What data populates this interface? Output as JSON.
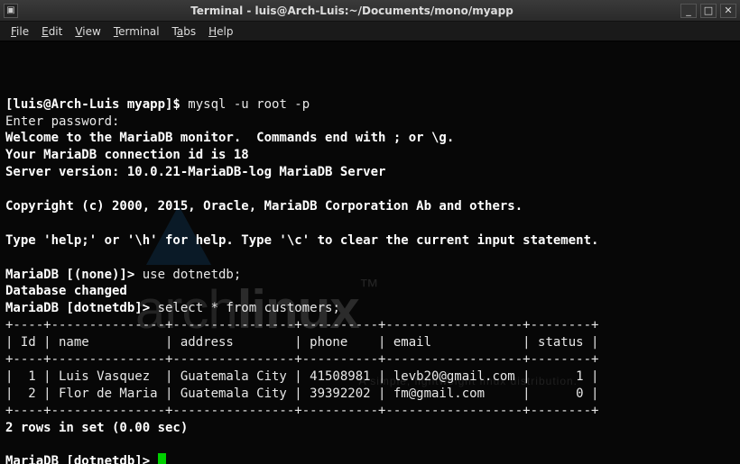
{
  "window": {
    "title": "Terminal - luis@Arch-Luis:~/Documents/mono/myapp"
  },
  "menu": {
    "file": "File",
    "edit": "Edit",
    "view": "View",
    "terminal": "Terminal",
    "tabs": "Tabs",
    "help": "Help"
  },
  "watermark": {
    "brand1": "arch",
    "brand2": "linux",
    "tagline": "A simple, lightweight linux distribution."
  },
  "session": {
    "shell_prompt": "[luis@Arch-Luis myapp]$ ",
    "cmd1": "mysql -u root -p",
    "enter_pw": "Enter password:",
    "welcome": "Welcome to the MariaDB monitor.  Commands end with ; or \\g.",
    "conn_id": "Your MariaDB connection id is 18",
    "server_ver": "Server version: 10.0.21-MariaDB-log MariaDB Server",
    "copyright": "Copyright (c) 2000, 2015, Oracle, MariaDB Corporation Ab and others.",
    "help_line": "Type 'help;' or '\\h' for help. Type '\\c' to clear the current input statement.",
    "prompt_none": "MariaDB [(none)]> ",
    "cmd_use": "use dotnetdb;",
    "db_changed": "Database changed",
    "prompt_db": "MariaDB [dotnetdb]> ",
    "cmd_select": "select * from customers;",
    "table_border": "+----+---------------+----------------+----------+------------------+--------+",
    "table_header": "| Id | name          | address        | phone    | email            | status |",
    "row1": "|  1 | Luis Vasquez  | Guatemala City | 41508981 | levb20@gmail.com |      1 |",
    "row2": "|  2 | Flor de Maria | Guatemala City | 39392202 | fm@gmail.com     |      0 |",
    "rowcount": "2 rows in set (0.00 sec)"
  },
  "chart_data": {
    "type": "table",
    "title": "customers",
    "columns": [
      "Id",
      "name",
      "address",
      "phone",
      "email",
      "status"
    ],
    "rows": [
      {
        "Id": 1,
        "name": "Luis Vasquez",
        "address": "Guatemala City",
        "phone": "41508981",
        "email": "levb20@gmail.com",
        "status": 1
      },
      {
        "Id": 2,
        "name": "Flor de Maria",
        "address": "Guatemala City",
        "phone": "39392202",
        "email": "fm@gmail.com",
        "status": 0
      }
    ],
    "row_count": 2,
    "elapsed_sec": 0.0
  }
}
